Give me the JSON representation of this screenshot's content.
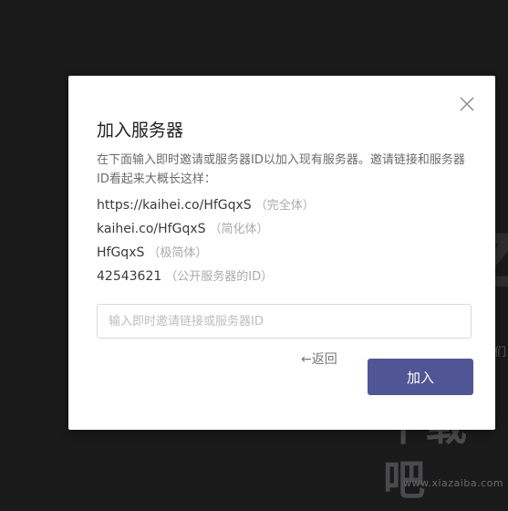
{
  "background": {
    "fragment_text": "们"
  },
  "watermark": {
    "main_text": "下载吧",
    "sub_text": "www.xiazaiba.com"
  },
  "dialog": {
    "title": "加入服务器",
    "description": "在下面输入即时邀请或服务器ID以加入现有服务器。邀请链接和服务器ID看起来大概长这样：",
    "examples": [
      {
        "value": "https://kaihei.co/HfGqxS",
        "note": "（完全体）"
      },
      {
        "value": "kaihei.co/HfGqxS",
        "note": "（简化体）"
      },
      {
        "value": "HfGqxS",
        "note": "（极简体）"
      },
      {
        "value": "42543621",
        "note": "（公开服务器的ID）"
      }
    ],
    "input": {
      "placeholder": "输入即时邀请链接或服务器ID",
      "value": ""
    },
    "back_label": "←返回",
    "join_label": "加入",
    "close_icon": "close-icon",
    "accent_color": "#4f5595"
  }
}
